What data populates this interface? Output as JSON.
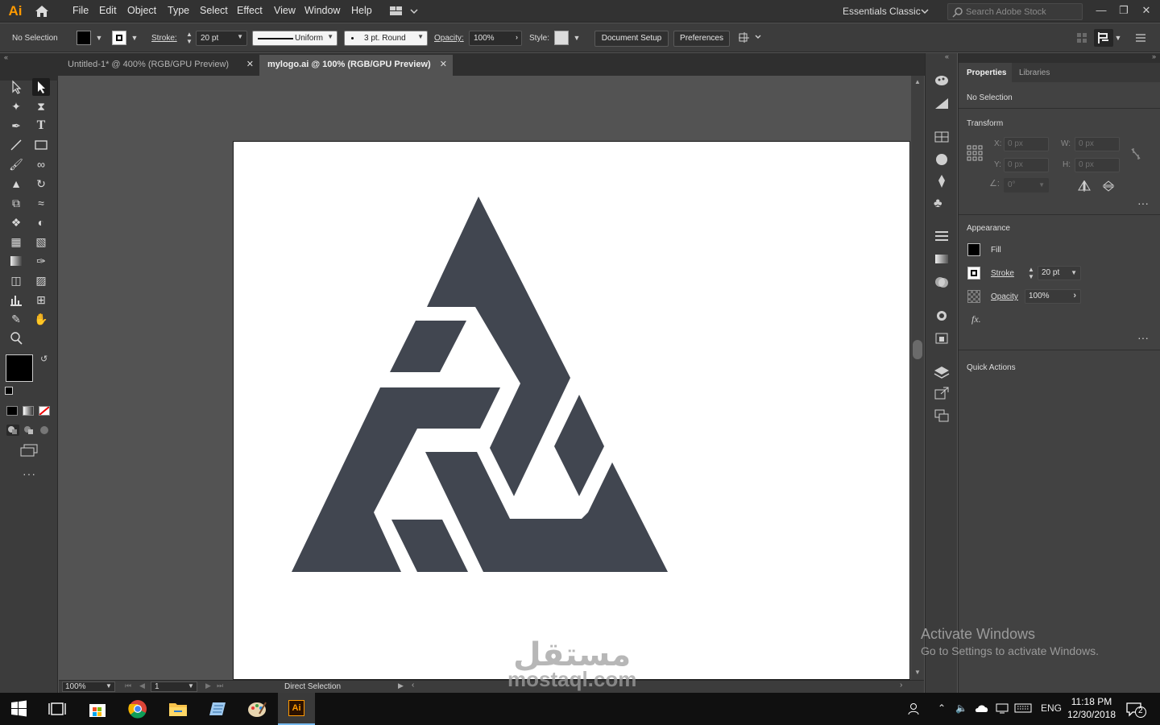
{
  "app": {
    "logo_text": "Ai",
    "accent": "#ff9a00"
  },
  "menu": [
    "File",
    "Edit",
    "Object",
    "Type",
    "Select",
    "Effect",
    "View",
    "Window",
    "Help"
  ],
  "workspace": {
    "label": "Essentials Classic"
  },
  "search": {
    "placeholder": "Search Adobe Stock"
  },
  "control_bar": {
    "selection": "No Selection",
    "stroke_label": "Stroke:",
    "stroke_value": "20 pt",
    "profile": "Uniform",
    "brush": "3 pt. Round",
    "opacity_label": "Opacity:",
    "opacity_value": "100%",
    "style_label": "Style:",
    "document_setup": "Document Setup",
    "preferences": "Preferences"
  },
  "tabs": [
    {
      "label": "Untitled-1* @ 400% (RGB/GPU Preview)",
      "active": false
    },
    {
      "label": "mylogo.ai @ 100% (RGB/GPU Preview)",
      "active": true
    }
  ],
  "status_bar": {
    "zoom": "100%",
    "artboard_number": "1",
    "tool": "Direct Selection"
  },
  "properties": {
    "tab_properties": "Properties",
    "tab_libraries": "Libraries",
    "selection": "No Selection",
    "transform": {
      "title": "Transform",
      "x_label": "X:",
      "y_label": "Y:",
      "w_label": "W:",
      "h_label": "H:",
      "x": "0 px",
      "y": "0 px",
      "w": "0 px",
      "h": "0 px",
      "angle": "0°"
    },
    "appearance": {
      "title": "Appearance",
      "fill": "Fill",
      "stroke": "Stroke",
      "stroke_value": "20 pt",
      "opacity": "Opacity",
      "opacity_value": "100%",
      "fx": "fx."
    },
    "quick_actions": "Quick Actions"
  },
  "logo": {
    "color": "#414650"
  },
  "watermark": {
    "line1": "Activate Windows",
    "line2": "Go to Settings to activate Windows."
  },
  "site_mark": {
    "arabic": "مستقل",
    "latin": "mostaql.com"
  },
  "taskbar": {
    "lang": "ENG",
    "time": "11:18 PM",
    "date": "12/30/2018",
    "notifications": "2"
  }
}
